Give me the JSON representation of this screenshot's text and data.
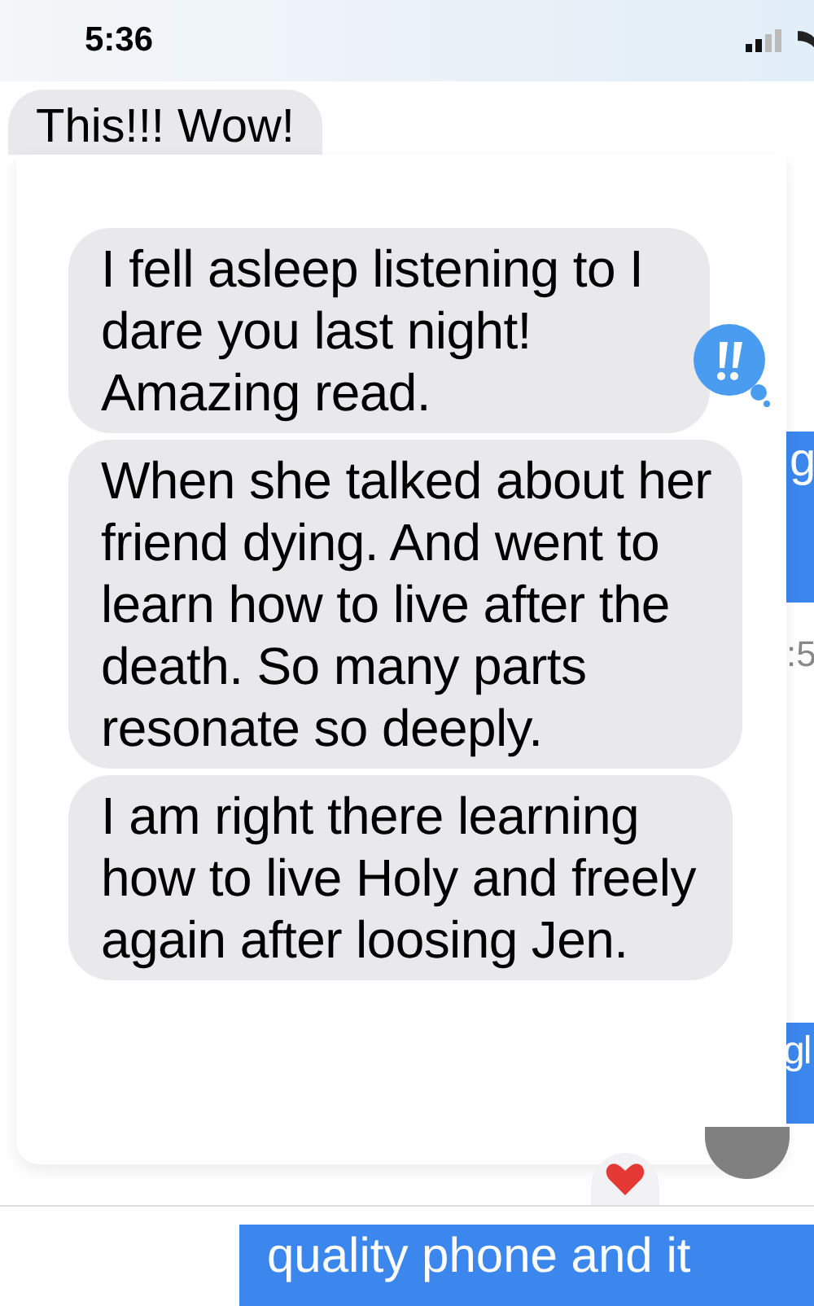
{
  "status_bar": {
    "time": "5:36"
  },
  "top_message": {
    "text": "This!!! Wow!"
  },
  "focused_messages": [
    {
      "text": "I fell asleep listening to I dare you last night! Amazing read."
    },
    {
      "text": "When she talked about her friend dying. And went to learn how to live after the death. So many parts resonate so deeply."
    },
    {
      "text": "I am right there learning how to live Holy and freely again after loosing Jen."
    }
  ],
  "reaction": {
    "kind": "exclamation"
  },
  "background_snippets": [
    "g",
    ":5",
    "gl"
  ],
  "bottom_message": {
    "text": "quality phone and it"
  }
}
